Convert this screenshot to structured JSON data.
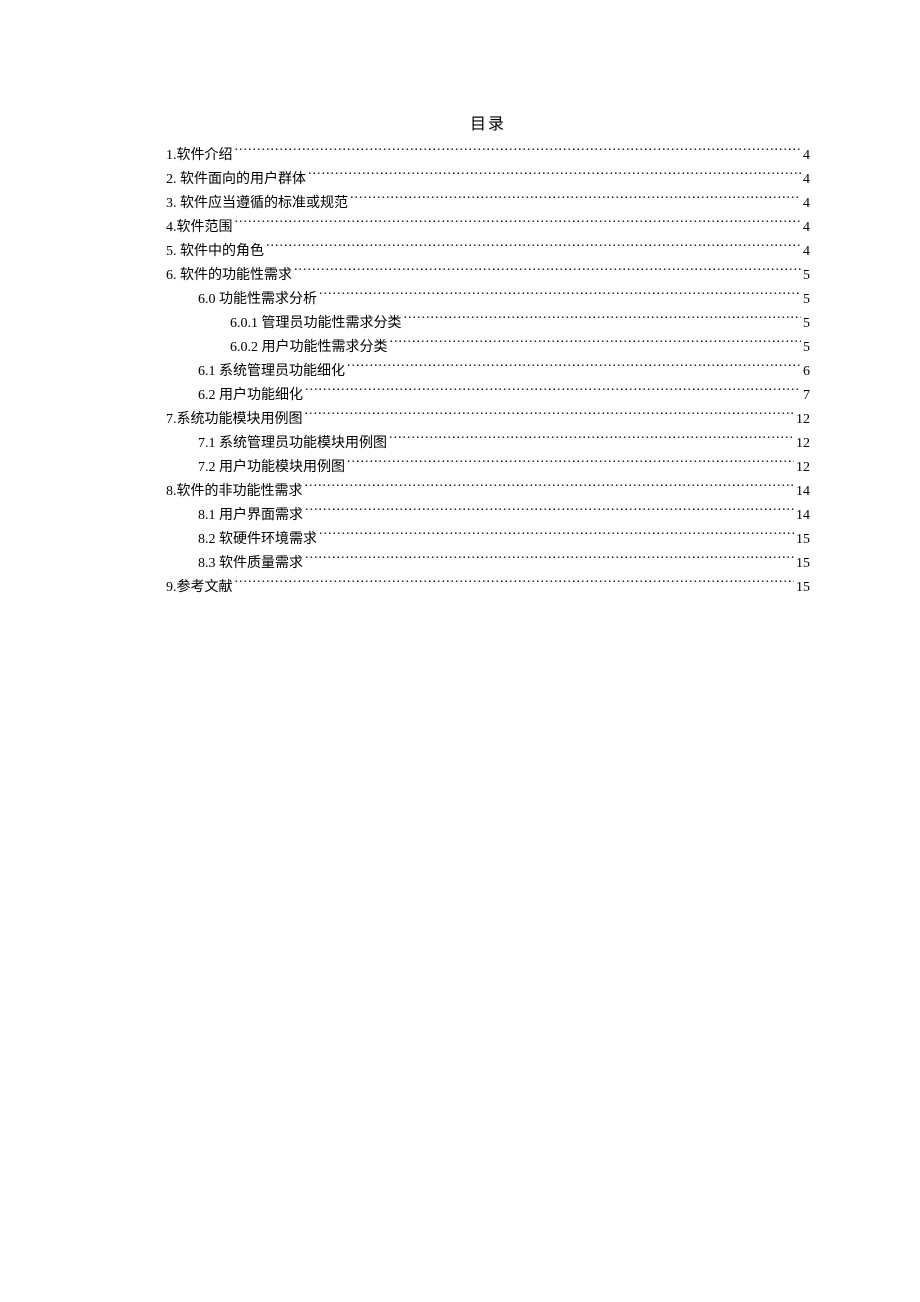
{
  "title": "目录",
  "entries": [
    {
      "indent": 0,
      "text": "1.软件介绍",
      "page": "4"
    },
    {
      "indent": 0,
      "text": "2.  软件面向的用户群体 ",
      "page": "4"
    },
    {
      "indent": 0,
      "text": "3.  软件应当遵循的标准或规范 ",
      "page": "4"
    },
    {
      "indent": 0,
      "text": "4.软件范围",
      "page": "4"
    },
    {
      "indent": 0,
      "text": "5.  软件中的角色 ",
      "page": "4"
    },
    {
      "indent": 0,
      "text": "6.  软件的功能性需求 ",
      "page": "5"
    },
    {
      "indent": 1,
      "text": "6.0 功能性需求分析 ",
      "page": "5"
    },
    {
      "indent": 2,
      "text": "6.0.1 管理员功能性需求分类",
      "page": "5"
    },
    {
      "indent": 2,
      "text": "6.0.2 用户功能性需求分类",
      "page": "5"
    },
    {
      "indent": 1,
      "text": "6.1  系统管理员功能细化",
      "page": "6"
    },
    {
      "indent": 1,
      "text": "6.2  用户功能细化",
      "page": "7"
    },
    {
      "indent": 0,
      "text": "7.系统功能模块用例图 ",
      "page": "12"
    },
    {
      "indent": 1,
      "text": "7.1 系统管理员功能模块用例图",
      "page": "12"
    },
    {
      "indent": 1,
      "text": "7.2 用户功能模块用例图",
      "page": "12"
    },
    {
      "indent": 0,
      "text": "8.软件的非功能性需求 ",
      "page": "14"
    },
    {
      "indent": 1,
      "text": "8.1  用户界面需求",
      "page": "14"
    },
    {
      "indent": 1,
      "text": "8.2  软硬件环境需求",
      "page": "15"
    },
    {
      "indent": 1,
      "text": "8.3  软件质量需求",
      "page": "15"
    },
    {
      "indent": 0,
      "text": "9.参考文献 ",
      "page": "15"
    }
  ]
}
